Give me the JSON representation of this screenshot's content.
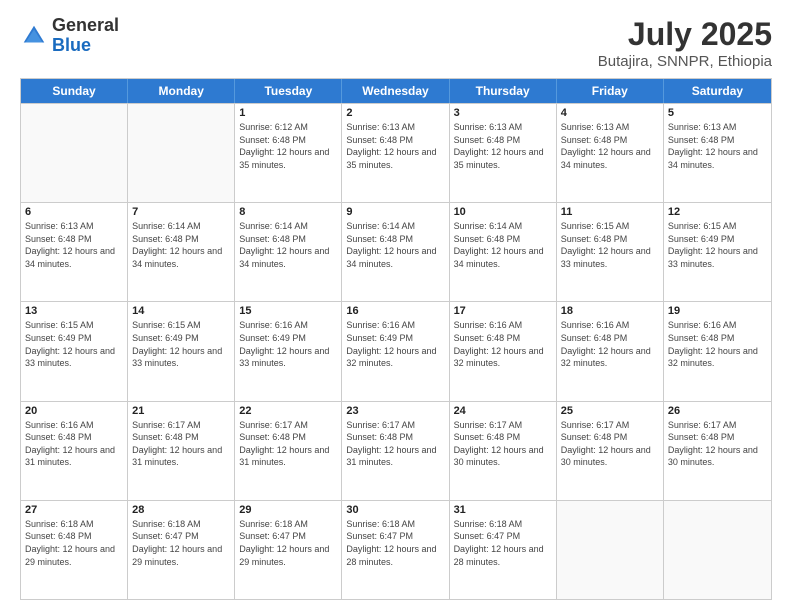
{
  "logo": {
    "general": "General",
    "blue": "Blue"
  },
  "header": {
    "title": "July 2025",
    "subtitle": "Butajira, SNNPR, Ethiopia"
  },
  "days": [
    "Sunday",
    "Monday",
    "Tuesday",
    "Wednesday",
    "Thursday",
    "Friday",
    "Saturday"
  ],
  "weeks": [
    [
      {
        "day": "",
        "empty": true
      },
      {
        "day": "",
        "empty": true
      },
      {
        "num": "1",
        "sunrise": "Sunrise: 6:12 AM",
        "sunset": "Sunset: 6:48 PM",
        "daylight": "Daylight: 12 hours and 35 minutes."
      },
      {
        "num": "2",
        "sunrise": "Sunrise: 6:13 AM",
        "sunset": "Sunset: 6:48 PM",
        "daylight": "Daylight: 12 hours and 35 minutes."
      },
      {
        "num": "3",
        "sunrise": "Sunrise: 6:13 AM",
        "sunset": "Sunset: 6:48 PM",
        "daylight": "Daylight: 12 hours and 35 minutes."
      },
      {
        "num": "4",
        "sunrise": "Sunrise: 6:13 AM",
        "sunset": "Sunset: 6:48 PM",
        "daylight": "Daylight: 12 hours and 34 minutes."
      },
      {
        "num": "5",
        "sunrise": "Sunrise: 6:13 AM",
        "sunset": "Sunset: 6:48 PM",
        "daylight": "Daylight: 12 hours and 34 minutes."
      }
    ],
    [
      {
        "num": "6",
        "sunrise": "Sunrise: 6:13 AM",
        "sunset": "Sunset: 6:48 PM",
        "daylight": "Daylight: 12 hours and 34 minutes."
      },
      {
        "num": "7",
        "sunrise": "Sunrise: 6:14 AM",
        "sunset": "Sunset: 6:48 PM",
        "daylight": "Daylight: 12 hours and 34 minutes."
      },
      {
        "num": "8",
        "sunrise": "Sunrise: 6:14 AM",
        "sunset": "Sunset: 6:48 PM",
        "daylight": "Daylight: 12 hours and 34 minutes."
      },
      {
        "num": "9",
        "sunrise": "Sunrise: 6:14 AM",
        "sunset": "Sunset: 6:48 PM",
        "daylight": "Daylight: 12 hours and 34 minutes."
      },
      {
        "num": "10",
        "sunrise": "Sunrise: 6:14 AM",
        "sunset": "Sunset: 6:48 PM",
        "daylight": "Daylight: 12 hours and 34 minutes."
      },
      {
        "num": "11",
        "sunrise": "Sunrise: 6:15 AM",
        "sunset": "Sunset: 6:48 PM",
        "daylight": "Daylight: 12 hours and 33 minutes."
      },
      {
        "num": "12",
        "sunrise": "Sunrise: 6:15 AM",
        "sunset": "Sunset: 6:49 PM",
        "daylight": "Daylight: 12 hours and 33 minutes."
      }
    ],
    [
      {
        "num": "13",
        "sunrise": "Sunrise: 6:15 AM",
        "sunset": "Sunset: 6:49 PM",
        "daylight": "Daylight: 12 hours and 33 minutes."
      },
      {
        "num": "14",
        "sunrise": "Sunrise: 6:15 AM",
        "sunset": "Sunset: 6:49 PM",
        "daylight": "Daylight: 12 hours and 33 minutes."
      },
      {
        "num": "15",
        "sunrise": "Sunrise: 6:16 AM",
        "sunset": "Sunset: 6:49 PM",
        "daylight": "Daylight: 12 hours and 33 minutes."
      },
      {
        "num": "16",
        "sunrise": "Sunrise: 6:16 AM",
        "sunset": "Sunset: 6:49 PM",
        "daylight": "Daylight: 12 hours and 32 minutes."
      },
      {
        "num": "17",
        "sunrise": "Sunrise: 6:16 AM",
        "sunset": "Sunset: 6:48 PM",
        "daylight": "Daylight: 12 hours and 32 minutes."
      },
      {
        "num": "18",
        "sunrise": "Sunrise: 6:16 AM",
        "sunset": "Sunset: 6:48 PM",
        "daylight": "Daylight: 12 hours and 32 minutes."
      },
      {
        "num": "19",
        "sunrise": "Sunrise: 6:16 AM",
        "sunset": "Sunset: 6:48 PM",
        "daylight": "Daylight: 12 hours and 32 minutes."
      }
    ],
    [
      {
        "num": "20",
        "sunrise": "Sunrise: 6:16 AM",
        "sunset": "Sunset: 6:48 PM",
        "daylight": "Daylight: 12 hours and 31 minutes."
      },
      {
        "num": "21",
        "sunrise": "Sunrise: 6:17 AM",
        "sunset": "Sunset: 6:48 PM",
        "daylight": "Daylight: 12 hours and 31 minutes."
      },
      {
        "num": "22",
        "sunrise": "Sunrise: 6:17 AM",
        "sunset": "Sunset: 6:48 PM",
        "daylight": "Daylight: 12 hours and 31 minutes."
      },
      {
        "num": "23",
        "sunrise": "Sunrise: 6:17 AM",
        "sunset": "Sunset: 6:48 PM",
        "daylight": "Daylight: 12 hours and 31 minutes."
      },
      {
        "num": "24",
        "sunrise": "Sunrise: 6:17 AM",
        "sunset": "Sunset: 6:48 PM",
        "daylight": "Daylight: 12 hours and 30 minutes."
      },
      {
        "num": "25",
        "sunrise": "Sunrise: 6:17 AM",
        "sunset": "Sunset: 6:48 PM",
        "daylight": "Daylight: 12 hours and 30 minutes."
      },
      {
        "num": "26",
        "sunrise": "Sunrise: 6:17 AM",
        "sunset": "Sunset: 6:48 PM",
        "daylight": "Daylight: 12 hours and 30 minutes."
      }
    ],
    [
      {
        "num": "27",
        "sunrise": "Sunrise: 6:18 AM",
        "sunset": "Sunset: 6:48 PM",
        "daylight": "Daylight: 12 hours and 29 minutes."
      },
      {
        "num": "28",
        "sunrise": "Sunrise: 6:18 AM",
        "sunset": "Sunset: 6:47 PM",
        "daylight": "Daylight: 12 hours and 29 minutes."
      },
      {
        "num": "29",
        "sunrise": "Sunrise: 6:18 AM",
        "sunset": "Sunset: 6:47 PM",
        "daylight": "Daylight: 12 hours and 29 minutes."
      },
      {
        "num": "30",
        "sunrise": "Sunrise: 6:18 AM",
        "sunset": "Sunset: 6:47 PM",
        "daylight": "Daylight: 12 hours and 28 minutes."
      },
      {
        "num": "31",
        "sunrise": "Sunrise: 6:18 AM",
        "sunset": "Sunset: 6:47 PM",
        "daylight": "Daylight: 12 hours and 28 minutes."
      },
      {
        "day": "",
        "empty": true
      },
      {
        "day": "",
        "empty": true
      }
    ]
  ]
}
